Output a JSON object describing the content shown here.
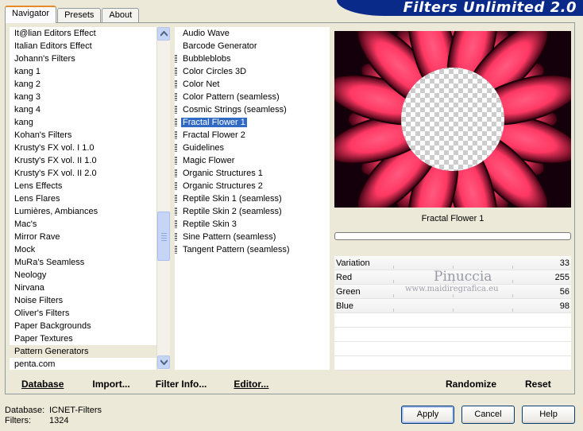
{
  "tabs": [
    "Navigator",
    "Presets",
    "About"
  ],
  "banner_title": "Filters Unlimited 2.0",
  "categories": [
    "It@lian Editors Effect",
    "Italian Editors Effect",
    "Johann's Filters",
    "kang 1",
    "kang 2",
    "kang 3",
    "kang 4",
    "kang",
    "Kohan's Filters",
    "Krusty's FX vol. I 1.0",
    "Krusty's FX vol. II 1.0",
    "Krusty's FX vol. II 2.0",
    "Lens Effects",
    "Lens Flares",
    "Lumières, Ambiances",
    "Mac's",
    "Mirror Rave",
    "Mock",
    "MuRa's Seamless",
    "Neology",
    "Nirvana",
    "Noise Filters",
    "Oliver's Filters",
    "Paper Backgrounds",
    "Paper Textures",
    "Pattern Generators",
    "penta.com"
  ],
  "selected_category": "Pattern Generators",
  "filters": [
    {
      "name": "Audio Wave",
      "marker": false
    },
    {
      "name": "Barcode Generator",
      "marker": false
    },
    {
      "name": "Bubbleblobs",
      "marker": true
    },
    {
      "name": "Color Circles 3D",
      "marker": true
    },
    {
      "name": "Color Net",
      "marker": true
    },
    {
      "name": "Color Pattern (seamless)",
      "marker": true
    },
    {
      "name": "Cosmic Strings (seamless)",
      "marker": true
    },
    {
      "name": "Fractal Flower 1",
      "marker": true
    },
    {
      "name": "Fractal Flower 2",
      "marker": true
    },
    {
      "name": "Guidelines",
      "marker": true
    },
    {
      "name": "Magic Flower",
      "marker": true
    },
    {
      "name": "Organic Structures 1",
      "marker": true
    },
    {
      "name": "Organic Structures 2",
      "marker": true
    },
    {
      "name": "Reptile Skin 1 (seamless)",
      "marker": true
    },
    {
      "name": "Reptile Skin 2 (seamless)",
      "marker": true
    },
    {
      "name": "Reptile Skin 3",
      "marker": true
    },
    {
      "name": "Sine Pattern (seamless)",
      "marker": true
    },
    {
      "name": "Tangent Pattern (seamless)",
      "marker": true
    }
  ],
  "selected_filter": "Fractal Flower 1",
  "preview_caption": "Fractal Flower 1",
  "params": [
    {
      "name": "Variation",
      "value": "33"
    },
    {
      "name": "Red",
      "value": "255"
    },
    {
      "name": "Green",
      "value": "56"
    },
    {
      "name": "Blue",
      "value": "98"
    }
  ],
  "watermark": {
    "name": "Pinuccia",
    "url": "www.maidiregrafica.eu"
  },
  "buttons": {
    "database": "Database",
    "import": "Import...",
    "filter_info": "Filter Info...",
    "editor": "Editor...",
    "randomize": "Randomize",
    "reset": "Reset",
    "apply": "Apply",
    "cancel": "Cancel",
    "help": "Help"
  },
  "status": {
    "database_label": "Database:",
    "database_value": "ICNET-Filters",
    "filters_label": "Filters:",
    "filters_value": "1324"
  },
  "colors": {
    "petal": "#ff3863",
    "selection": "#316ac5",
    "banner": "#0a2a8a"
  }
}
